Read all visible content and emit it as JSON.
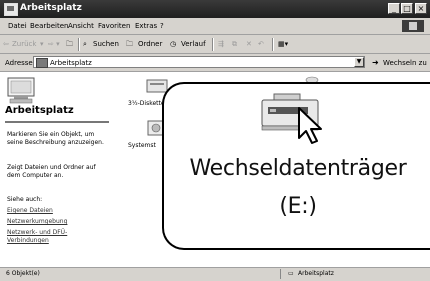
{
  "window": {
    "title": "Arbeitsplatz",
    "controls": [
      "_",
      "□",
      "×"
    ]
  },
  "menu": [
    "Datei",
    "Bearbeiten",
    "Ansicht",
    "Favoriten",
    "Extras",
    "?"
  ],
  "toolbar": {
    "back": "Zurück",
    "search": "Suchen",
    "folders": "Ordner",
    "history": "Verlauf"
  },
  "address": {
    "label": "Adresse",
    "value": "Arbeitsplatz",
    "go": "Wechseln zu"
  },
  "left_pane": {
    "heading": "Arbeitsplatz",
    "description": "Markieren Sie ein Objekt, um seine Beschreibung anzuzeigen.",
    "description2": "Zeigt Dateien und Ordner auf dem Computer an.",
    "see_also": "Siehe auch:",
    "links": [
      "Eigene Dateien",
      "Netzwerkumgebung",
      "Netzwerk- und DFÜ-Verbindungen"
    ]
  },
  "content": {
    "items": [
      "3½-Diskette",
      "Systemst"
    ]
  },
  "callout": {
    "drive_label": "Wechseldatenträger",
    "drive_letter": "(E:)"
  },
  "status": {
    "left": "6 Objekt(e)",
    "right": "Arbeitsplatz"
  },
  "colors": {
    "titlebar": "#2a2a2a",
    "chrome": "#d6d3ce"
  }
}
